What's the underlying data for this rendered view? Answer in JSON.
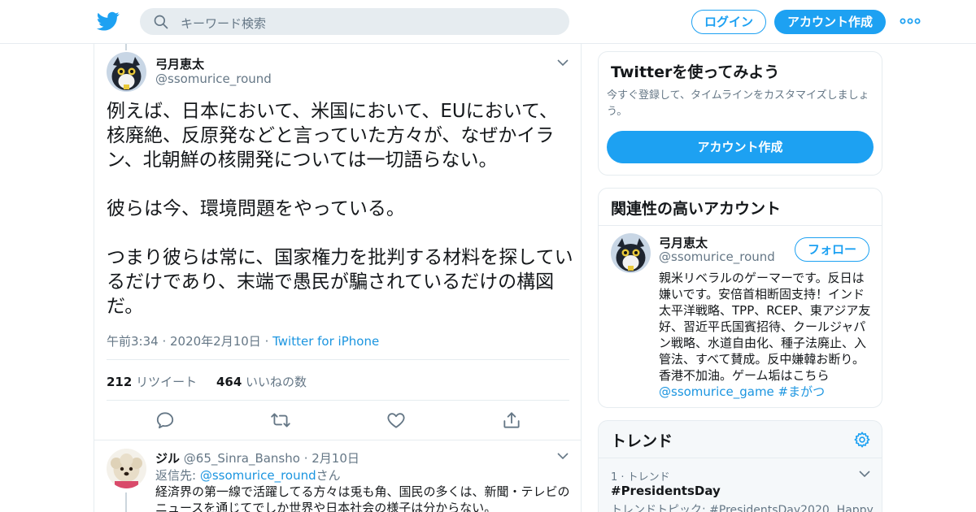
{
  "header": {
    "search_placeholder": "キーワード検索",
    "login_label": "ログイン",
    "signup_label": "アカウント作成"
  },
  "tweet": {
    "display_name": "弓月恵太",
    "handle": "@ssomurice_round",
    "text": "例えば、日本において、米国において、EUにおいて、核廃絶、反原発などと言っていた方々が、なぜかイラン、北朝鮮の核開発については一切語らない。\n\n彼らは今、環境問題をやっている。\n\nつまり彼らは常に、国家権力を批判する材料を探しているだけであり、末端で愚民が騙されているだけの構図だ。",
    "timestamp": "午前3:34 · 2020年2月10日",
    "separator": " · ",
    "source": "Twitter for iPhone",
    "retweet_count": "212",
    "retweet_label": "リツイート",
    "like_count": "464",
    "like_label": "いいねの数"
  },
  "reply": {
    "display_name": "ジル",
    "handle": "@65_Sinra_Bansho",
    "date": "· 2月10日",
    "reply_prefix": "返信先: ",
    "reply_to": "@ssomurice_round",
    "reply_suffix": "さん",
    "text": "経済界の第一線で活躍してる方々は兎も角、国民の多くは、新聞・テレビのニュースを通じてでしか世界や日本社会の様子は分からない。"
  },
  "signup_card": {
    "title": "Twitterを使ってみよう",
    "subtitle": "今すぐ登録して、タイムラインをカスタマイズしましょう。",
    "button_label": "アカウント作成"
  },
  "related_card": {
    "title": "関連性の高いアカウント",
    "display_name": "弓月恵太",
    "handle": "@ssomurice_round",
    "follow_label": "フォロー",
    "bio": "親米リベラルのゲーマーです。反日は嫌いです。安倍首相断固支持！インド太平洋戦略、TPP、RCEP、東アジア友好、習近平氏国賓招待、クールジャパン戦略、水道自由化、種子法廃止、入管法、すべて賛成。反中嫌韓お断り。香港不加油。ゲーム垢はこちら",
    "bio_link": "@ssomurice_game #まがつ"
  },
  "trends_card": {
    "title": "トレンド",
    "rank": "1 · トレンド",
    "tag": "#PresidentsDay",
    "topic": "トレンドトピック: #PresidentsDay2020, Happy"
  },
  "colors": {
    "brand": "#1da1f2",
    "link": "#1b95e0",
    "muted": "#657786",
    "border": "#e6ecf0"
  },
  "icons": [
    "twitter-bird-icon",
    "search-icon",
    "more-dots-icon",
    "chevron-down-icon",
    "reply-icon",
    "retweet-icon",
    "like-icon",
    "share-icon",
    "gear-icon"
  ]
}
